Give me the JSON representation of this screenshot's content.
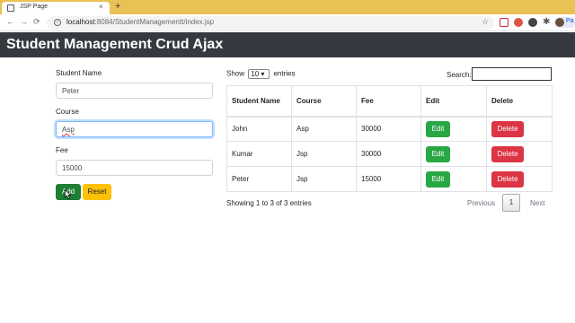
{
  "browser": {
    "tab_title": "JSP Page",
    "tab_close": "×",
    "new_tab": "+",
    "url_host": "localhost",
    "url_rest": ":8084/StudentManagementt/index.jsp",
    "back": "←",
    "forward": "→",
    "reload": "⟳",
    "star": "☆",
    "profile_initial": "Pa"
  },
  "header": {
    "title": "Student Management Crud Ajax",
    "bg_color": "#343a40"
  },
  "form": {
    "name_label": "Student Name",
    "name_value": "Peter",
    "course_label": "Course",
    "course_value": "Asp",
    "fee_label": "Fee",
    "fee_value": "15000",
    "add_label": "Add",
    "reset_label": "Reset"
  },
  "table_controls": {
    "show_label": "Show",
    "entries_value": "10",
    "entries_label": "entries",
    "search_label": "Search:"
  },
  "table": {
    "headers": [
      "Student Name",
      "Course",
      "Fee",
      "Edit",
      "Delete"
    ],
    "rows": [
      {
        "name": "John",
        "course": "Asp",
        "fee": "30000",
        "edit": "Edit",
        "delete": "Delete"
      },
      {
        "name": "Kumar",
        "course": "Jsp",
        "fee": "30000",
        "edit": "Edit",
        "delete": "Delete"
      },
      {
        "name": "Peter",
        "course": "Jsp",
        "fee": "15000",
        "edit": "Edit",
        "delete": "Delete"
      }
    ],
    "info": "Showing 1 to 3 of 3 entries",
    "pagination": {
      "previous": "Previous",
      "current": "1",
      "next": "Next"
    }
  },
  "colors": {
    "tabbar": "#e9c255",
    "edit_button": "#28a745",
    "delete_button": "#dc3545",
    "add_button": "#1e7e34",
    "reset_button": "#ffc107"
  }
}
